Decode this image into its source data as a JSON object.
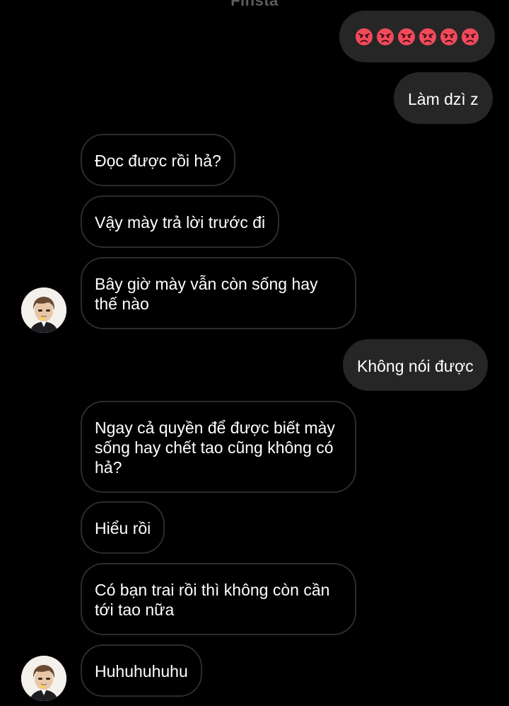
{
  "chat": {
    "header_name": "Finsta",
    "messages": [
      {
        "id": "m1",
        "side": "out",
        "type": "emoji",
        "emoji_icon": "angry-face-icon",
        "emoji_count": 6,
        "emoji_color": "#f04a5c"
      },
      {
        "id": "m2",
        "side": "out",
        "text": "Làm dzì z"
      },
      {
        "id": "m3",
        "side": "in",
        "text": "Đọc được rồi hả?"
      },
      {
        "id": "m4",
        "side": "in",
        "text": "Vậy mày trả lời trước đi"
      },
      {
        "id": "m5",
        "side": "in",
        "text": "Bây giờ mày vẫn còn sống hay thế nào",
        "show_avatar": true
      },
      {
        "id": "m6",
        "side": "out",
        "text": "Không nói được"
      },
      {
        "id": "m7",
        "side": "in",
        "text": "Ngay cả quyền để được biết mày sống hay chết tao cũng không có hả?"
      },
      {
        "id": "m8",
        "side": "in",
        "text": "Hiểu rồi"
      },
      {
        "id": "m9",
        "side": "in",
        "text": "Có bạn trai rồi thì không còn cần tới tao nữa"
      },
      {
        "id": "m10",
        "side": "in",
        "text": "Huhuhuhuhu",
        "show_avatar": true
      }
    ]
  },
  "colors": {
    "background": "#000000",
    "outgoing_bubble": "#262626",
    "incoming_border": "#2c2c2c",
    "text": "#ffffff"
  }
}
